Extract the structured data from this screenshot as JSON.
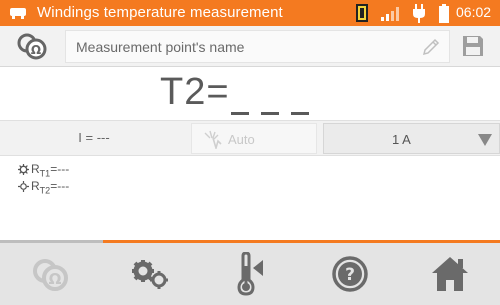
{
  "status_bar": {
    "title": "Windings temperature measurement",
    "time": "06:02",
    "icons": [
      "app-icon",
      "sd-card-icon",
      "signal-icon",
      "power-plug-icon",
      "battery-icon"
    ]
  },
  "name_row": {
    "label": "Measurement point's name",
    "icons": [
      "meas-mode-icon",
      "pencil-icon",
      "save-icon"
    ]
  },
  "result": {
    "prefix": "T2="
  },
  "params": {
    "current": "I = ---",
    "auto": "Auto",
    "range": "1 A"
  },
  "readings": [
    {
      "base": "R",
      "sub": "T1",
      "tail": "=---",
      "icon": "cog-icon"
    },
    {
      "base": "R",
      "sub": "T2",
      "tail": "=---",
      "icon": "sun-icon"
    }
  ],
  "bottom_bar": {
    "buttons": [
      "measurement-icon",
      "settings-icon",
      "thermometer-icon",
      "help-icon",
      "home-icon"
    ]
  },
  "colors": {
    "accent": "#f47a20",
    "panel": "#f2f2f2",
    "bottom": "#e4e4e4",
    "icon": "#6a6a6a"
  }
}
